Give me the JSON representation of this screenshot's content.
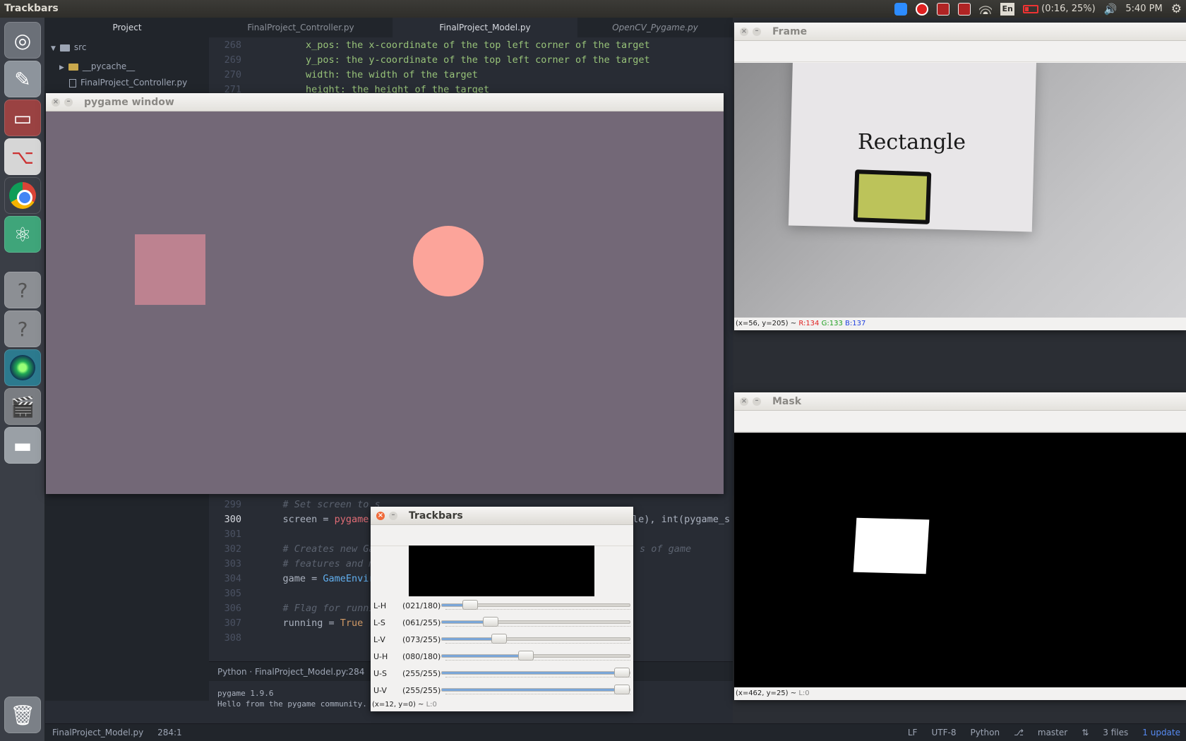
{
  "topbar": {
    "app_title": "Trackbars",
    "lang": "En",
    "battery": "(0:16, 25%)",
    "clock": "5:40 PM"
  },
  "launcher": {
    "items": [
      "ubuntu-icon",
      "settings-icon",
      "files-icon",
      "git-icon",
      "chrome-icon",
      "atom-icon",
      "unknown-app-icon",
      "unknown-app-icon",
      "camera-app-icon",
      "video-editor-icon",
      "drive-icon",
      "trash-icon"
    ]
  },
  "editor": {
    "tabs": [
      "Project",
      "FinalProject_Controller.py",
      "FinalProject_Model.py",
      "OpenCV_Pygame.py"
    ],
    "tree": {
      "root": "src",
      "items": [
        "__pycache__",
        "FinalProject_Controller.py"
      ]
    },
    "code_top": [
      {
        "n": "268",
        "t": "        x_pos: the x-coordinate of the top left corner of the target"
      },
      {
        "n": "269",
        "t": "        y_pos: the y-coordinate of the top left corner of the target"
      },
      {
        "n": "270",
        "t": "        width: the width of the target"
      },
      {
        "n": "271",
        "t": "        height: the height of the target"
      }
    ],
    "code_bottom": [
      {
        "n": "299",
        "a": "    ",
        "b": "# Set screen to s"
      },
      {
        "n": "300",
        "a": "    screen = ",
        "b": "pygame.d"
      },
      {
        "n": "301",
        "a": "",
        "b": ""
      },
      {
        "n": "302",
        "a": "    ",
        "b": "# Creates new Ga"
      },
      {
        "n": "303",
        "a": "    ",
        "b": "# features and m"
      },
      {
        "n": "304",
        "a": "    game = ",
        "b": "GameEnviro"
      },
      {
        "n": "305",
        "a": "",
        "b": ""
      },
      {
        "n": "306",
        "a": "    ",
        "b": "# Flag for runni"
      },
      {
        "n": "307",
        "a": "    running = ",
        "b": "True"
      },
      {
        "n": "308",
        "a": "",
        "b": ""
      }
    ],
    "code_right_300": "le), int(pygame_s",
    "code_right_302": "s of game",
    "status_file": "Python · FinalProject_Model.py:284",
    "console": [
      "pygame 1.9.6",
      "Hello from the pygame community."
    ]
  },
  "bottombar": {
    "file": "FinalProject_Model.py",
    "pos": "284:1",
    "lf": "LF",
    "enc": "UTF-8",
    "lang": "Python",
    "branch": "master",
    "files": "3 files",
    "update": "1 update"
  },
  "pygame_window": {
    "title": "pygame window",
    "colors": {
      "bg": "#736877",
      "rect": "#bd8290",
      "circle": "#fca49a"
    }
  },
  "frame_window": {
    "title": "Frame",
    "paper_label": "Rectangle",
    "status_pos": "(x=56, y=205) ~ ",
    "status_r": "R:134",
    "status_g": "G:133",
    "status_b": "B:137"
  },
  "mask_window": {
    "title": "Mask",
    "status_pos": "(x=462, y=25) ~ ",
    "status_l": "L:0"
  },
  "trackbars_window": {
    "title": "Trackbars",
    "sliders": [
      {
        "label": "L-H",
        "value": "(021/180)",
        "fraction": 0.117
      },
      {
        "label": "L-S",
        "value": "(061/255)",
        "fraction": 0.239
      },
      {
        "label": "L-V",
        "value": "(073/255)",
        "fraction": 0.286
      },
      {
        "label": "U-H",
        "value": "(080/180)",
        "fraction": 0.444
      },
      {
        "label": "U-S",
        "value": "(255/255)",
        "fraction": 1.0
      },
      {
        "label": "U-V",
        "value": "(255/255)",
        "fraction": 1.0
      }
    ],
    "status_pos": "(x=12, y=0) ~ ",
    "status_l": "L:0"
  }
}
